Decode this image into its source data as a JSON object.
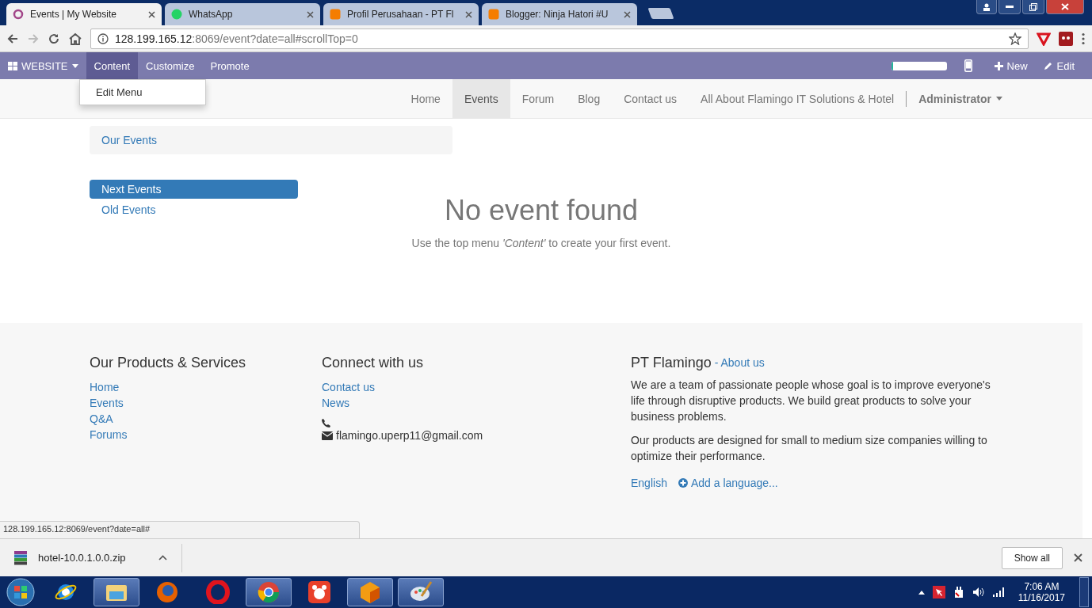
{
  "browser": {
    "tabs": [
      {
        "title": "Events | My Website",
        "selected": true
      },
      {
        "title": "WhatsApp",
        "selected": false
      },
      {
        "title": "Profil Perusahaan - PT Fl",
        "selected": false
      },
      {
        "title": "Blogger: Ninja Hatori #U",
        "selected": false
      }
    ],
    "address": {
      "host": "128.199.165.12",
      "path": ":8069/event?date=all#scrollTop=0"
    }
  },
  "editor_bar": {
    "menu": [
      {
        "label": "WEBSITE",
        "selected": false
      },
      {
        "label": "Content",
        "selected": true
      },
      {
        "label": "Customize",
        "selected": false
      },
      {
        "label": "Promote",
        "selected": false
      }
    ],
    "progress": {
      "level": 0.04
    },
    "new_label": "New",
    "edit_label": "Edit"
  },
  "dropdown": {
    "items": [
      "Edit Menu"
    ]
  },
  "navbar": {
    "items": [
      {
        "label": "Home",
        "selected": false
      },
      {
        "label": "Events",
        "selected": true
      },
      {
        "label": "Forum",
        "selected": false
      },
      {
        "label": "Blog",
        "selected": false
      },
      {
        "label": "Contact us",
        "selected": false
      },
      {
        "label": "All About Flamingo IT Solutions & Hotel",
        "selected": false
      }
    ],
    "user": "Administrator"
  },
  "breadcrumb": "Our Events",
  "sidebar": [
    {
      "label": "Next Events",
      "selected": true
    },
    {
      "label": "Old Events",
      "selected": false
    }
  ],
  "empty": {
    "title": "No event found",
    "message": "Use the top menu *'Content'* to create your first event."
  },
  "footer": {
    "products": {
      "title": "Our Products & Services",
      "links": [
        "Home",
        "Events",
        "Q&A",
        "Forums"
      ]
    },
    "connect": {
      "title": "Connect with us",
      "links": [
        "Contact us",
        "News"
      ],
      "email": "flamingo.uperp11@gmail.com"
    },
    "about": {
      "title": "PT Flamingo",
      "link": "- About us",
      "paragraphs": [
        "We are a team of passionate people whose goal is to improve everyone's life through disruptive products. We build great products to solve your business problems.",
        "Our products are designed for small to medium size companies willing to optimize their performance."
      ],
      "language": "English",
      "add_language": "Add a language..."
    }
  },
  "status_url": "128.199.165.12:8069/event?date=all#",
  "downloads": {
    "file": "hotel-10.0.1.0.0.zip",
    "show_all": "Show all"
  },
  "taskbar": {
    "apps": [
      {
        "running": false
      },
      {
        "running": true
      },
      {
        "running": false
      },
      {
        "running": false
      },
      {
        "running": true
      },
      {
        "running": false
      },
      {
        "running": true
      },
      {
        "running": true
      }
    ],
    "time": "7:06 AM",
    "date": "11/16/2017"
  }
}
